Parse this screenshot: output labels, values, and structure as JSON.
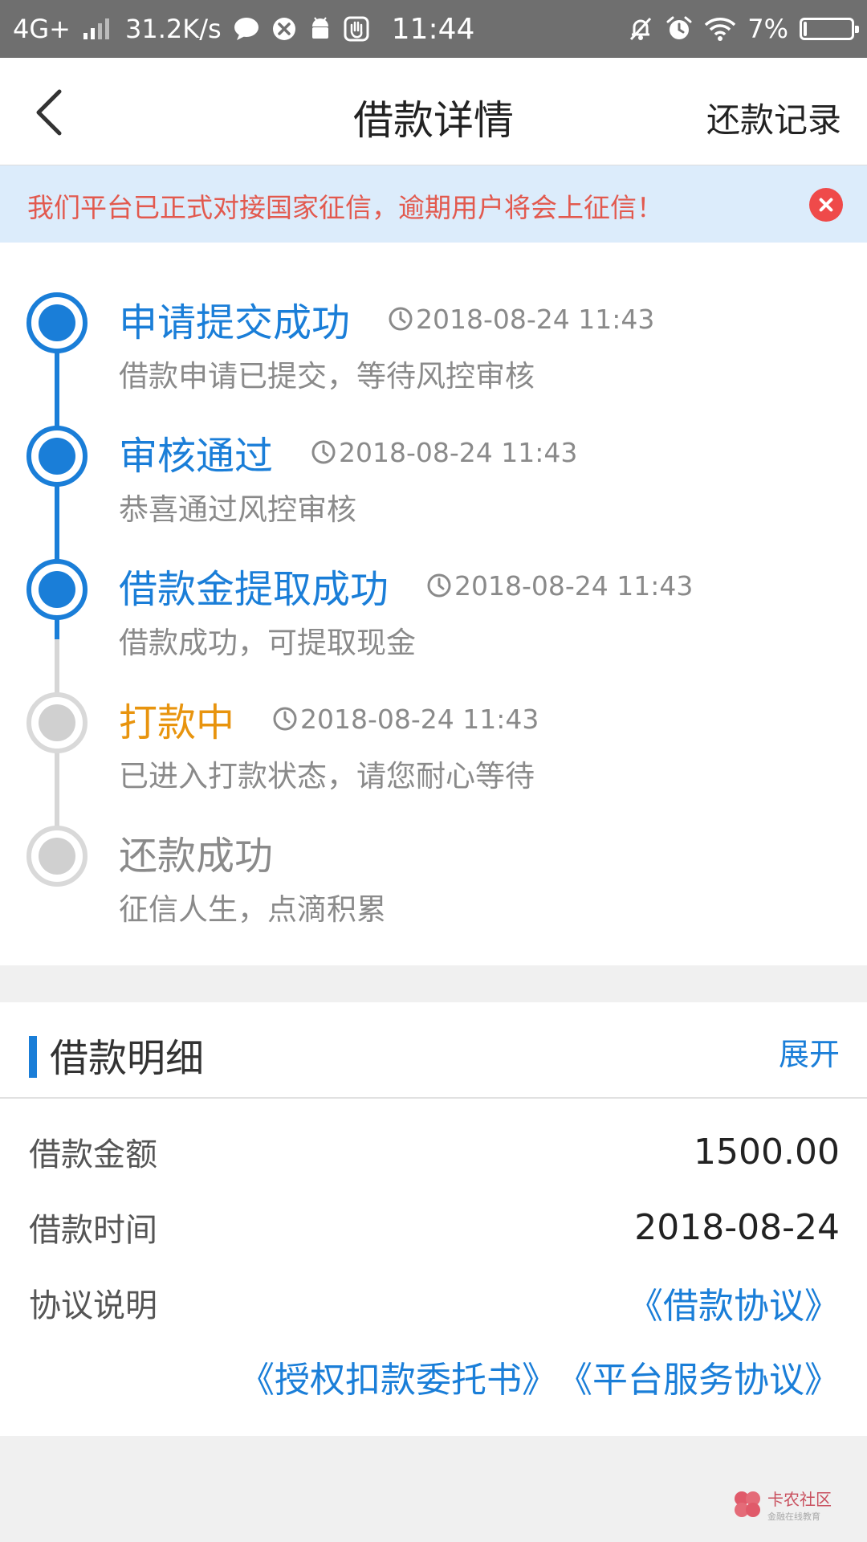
{
  "status_bar": {
    "network": "4G+",
    "speed": "31.2K/s",
    "time": "11:44",
    "battery_text": "7%",
    "battery_level": 0.07
  },
  "navbar": {
    "title": "借款详情",
    "action": "还款记录"
  },
  "notice": {
    "text": "我们平台已正式对接国家征信，逾期用户将会上征信！"
  },
  "timeline": {
    "steps": [
      {
        "title": "申请提交成功",
        "time": "2018-08-24 11:43",
        "desc": "借款申请已提交，等待风控审核",
        "state": "done",
        "color": "#1a7ed8"
      },
      {
        "title": "审核通过",
        "time": "2018-08-24 11:43",
        "desc": "恭喜通过风控审核",
        "state": "done",
        "color": "#1a7ed8"
      },
      {
        "title": "借款金提取成功",
        "time": "2018-08-24 11:43",
        "desc": "借款成功，可提取现金",
        "state": "done",
        "color": "#1a7ed8"
      },
      {
        "title": "打款中",
        "time": "2018-08-24 11:43",
        "desc": "已进入打款状态，请您耐心等待",
        "state": "active",
        "color": "#e8940e"
      },
      {
        "title": "还款成功",
        "time": "",
        "desc": "征信人生，点滴积累",
        "state": "pending",
        "color": "#8a8a8a"
      }
    ]
  },
  "detail": {
    "title": "借款明细",
    "toggle": "展开",
    "rows": [
      {
        "label": "借款金额",
        "value": "1500.00"
      },
      {
        "label": "借款时间",
        "value": "2018-08-24"
      }
    ],
    "agreement_label": "协议说明",
    "agreements": [
      "《借款协议》",
      "《授权扣款委托书》",
      "《平台服务协议》"
    ]
  },
  "watermark": {
    "text": "卡农社区",
    "subtext": "金融在线教育"
  }
}
